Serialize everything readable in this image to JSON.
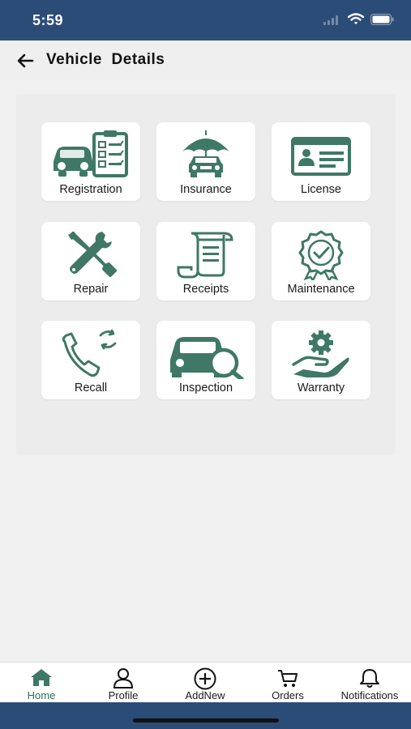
{
  "status_bar": {
    "time": "5:59"
  },
  "header": {
    "title": "Vehicle  Details",
    "back_icon": "arrow-left-icon"
  },
  "colors": {
    "accent": "#3f7866",
    "status_bar": "#2c4c78",
    "active_tab": "#2f6e5a"
  },
  "grid": {
    "tiles": [
      {
        "label": "Registration",
        "icon": "car-checklist-icon"
      },
      {
        "label": "Insurance",
        "icon": "car-umbrella-icon"
      },
      {
        "label": "License",
        "icon": "id-card-icon"
      },
      {
        "label": "Repair",
        "icon": "wrench-screwdriver-icon"
      },
      {
        "label": "Receipts",
        "icon": "receipt-scroll-icon"
      },
      {
        "label": "Maintenance",
        "icon": "award-badge-icon"
      },
      {
        "label": "Recall",
        "icon": "phone-refresh-icon"
      },
      {
        "label": "Inspection",
        "icon": "car-magnifier-icon"
      },
      {
        "label": "Warranty",
        "icon": "gear-hand-icon"
      }
    ]
  },
  "tabbar": {
    "tabs": [
      {
        "label": "Home",
        "icon": "home-icon",
        "active": true
      },
      {
        "label": "Profile",
        "icon": "person-icon",
        "active": false
      },
      {
        "label": "AddNew",
        "icon": "plus-circle-icon",
        "active": false
      },
      {
        "label": "Orders",
        "icon": "cart-icon",
        "active": false
      },
      {
        "label": "Notifications",
        "icon": "bell-icon",
        "active": false
      }
    ]
  }
}
